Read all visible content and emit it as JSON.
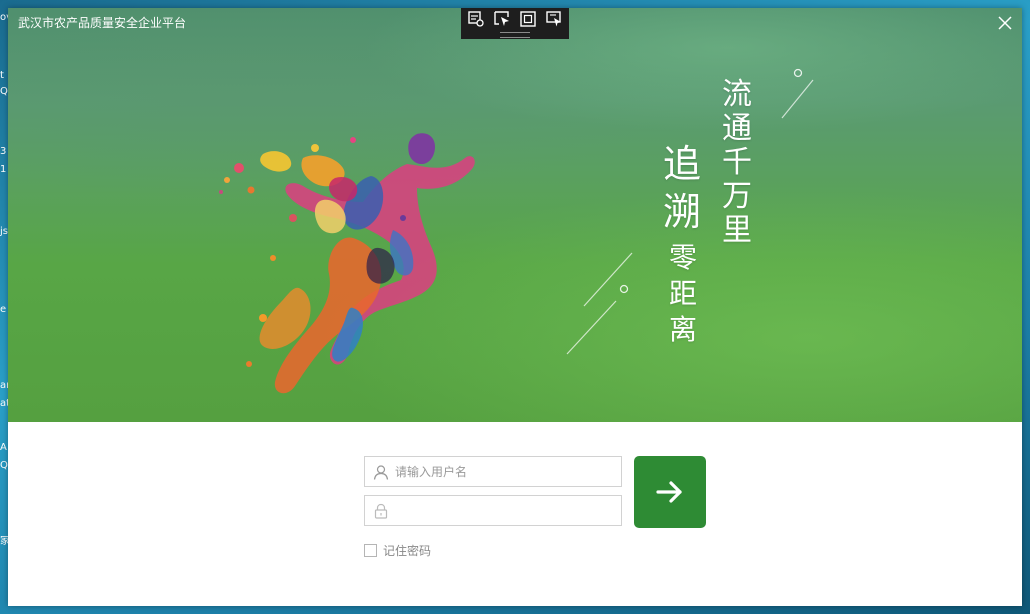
{
  "window": {
    "title": "武汉市农产品质量安全企业平台",
    "close_icon": "close-icon"
  },
  "capture_toolbar": {
    "icons": [
      "capture-settings-icon",
      "pointer-capture-icon",
      "fullscreen-capture-icon",
      "region-capture-icon"
    ]
  },
  "banner": {
    "slogan_right": [
      "流",
      "通",
      "千",
      "万",
      "里"
    ],
    "slogan_left_big": [
      "追",
      "溯"
    ],
    "slogan_left_small": [
      "零",
      "距",
      "离"
    ],
    "illustration": "colorful-running-man-illustration"
  },
  "login": {
    "username": {
      "placeholder": "请输入用户名",
      "value": "",
      "icon": "user-icon"
    },
    "password": {
      "placeholder": "",
      "value": "",
      "icon": "lock-icon"
    },
    "submit_icon": "arrow-right-icon",
    "remember_label": "记住密码",
    "remember_checked": false,
    "accent_color": "#2e8b34"
  },
  "desktop_fragments": [
    "ov",
    "t",
    "Q",
    "3",
    "1",
    "js",
    "e",
    "ar",
    "at",
    "A",
    "Q",
    "家"
  ]
}
